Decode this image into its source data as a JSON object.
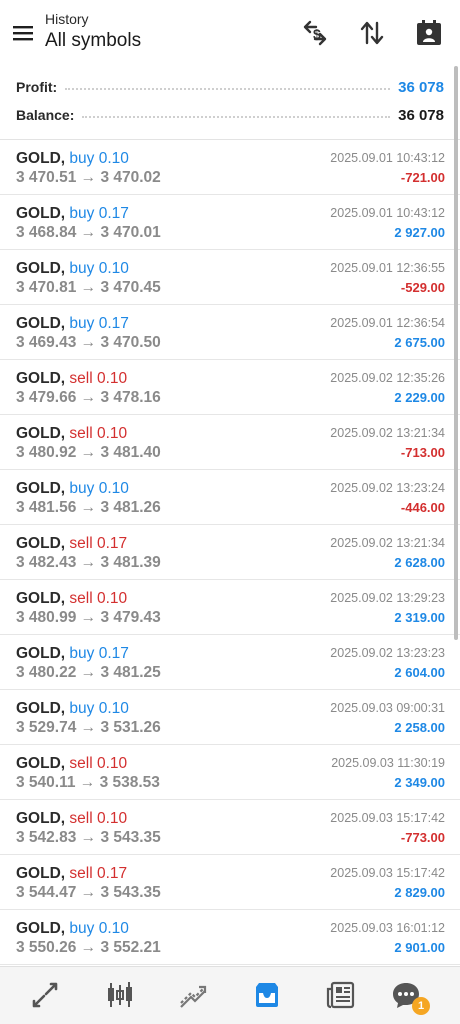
{
  "header": {
    "subtitle": "History",
    "title": "All symbols"
  },
  "summary": {
    "profit_label": "Profit:",
    "profit_value": "36 078",
    "balance_label": "Balance:",
    "balance_value": "36 078"
  },
  "colors": {
    "buy": "#1e88e5",
    "sell": "#d32f2f",
    "profit_positive": "#1e88e5",
    "profit_negative": "#d32f2f",
    "badge": "#f5a623"
  },
  "deals": [
    {
      "symbol": "GOLD,",
      "side": "buy",
      "volume": "0.10",
      "prices": "3 470.51 → 3 470.02",
      "time": "2025.09.01 10:43:12",
      "profit": "-721.00",
      "negative": true
    },
    {
      "symbol": "GOLD,",
      "side": "buy",
      "volume": "0.17",
      "prices": "3 468.84 → 3 470.01",
      "time": "2025.09.01 10:43:12",
      "profit": "2 927.00",
      "negative": false
    },
    {
      "symbol": "GOLD,",
      "side": "buy",
      "volume": "0.10",
      "prices": "3 470.81 → 3 470.45",
      "time": "2025.09.01 12:36:55",
      "profit": "-529.00",
      "negative": true
    },
    {
      "symbol": "GOLD,",
      "side": "buy",
      "volume": "0.17",
      "prices": "3 469.43 → 3 470.50",
      "time": "2025.09.01 12:36:54",
      "profit": "2 675.00",
      "negative": false
    },
    {
      "symbol": "GOLD,",
      "side": "sell",
      "volume": "0.10",
      "prices": "3 479.66 → 3 478.16",
      "time": "2025.09.02 12:35:26",
      "profit": "2 229.00",
      "negative": false
    },
    {
      "symbol": "GOLD,",
      "side": "sell",
      "volume": "0.10",
      "prices": "3 480.92 → 3 481.40",
      "time": "2025.09.02 13:21:34",
      "profit": "-713.00",
      "negative": true
    },
    {
      "symbol": "GOLD,",
      "side": "buy",
      "volume": "0.10",
      "prices": "3 481.56 → 3 481.26",
      "time": "2025.09.02 13:23:24",
      "profit": "-446.00",
      "negative": true
    },
    {
      "symbol": "GOLD,",
      "side": "sell",
      "volume": "0.17",
      "prices": "3 482.43 → 3 481.39",
      "time": "2025.09.02 13:21:34",
      "profit": "2 628.00",
      "negative": false
    },
    {
      "symbol": "GOLD,",
      "side": "sell",
      "volume": "0.10",
      "prices": "3 480.99 → 3 479.43",
      "time": "2025.09.02 13:29:23",
      "profit": "2 319.00",
      "negative": false
    },
    {
      "symbol": "GOLD,",
      "side": "buy",
      "volume": "0.17",
      "prices": "3 480.22 → 3 481.25",
      "time": "2025.09.02 13:23:23",
      "profit": "2 604.00",
      "negative": false
    },
    {
      "symbol": "GOLD,",
      "side": "buy",
      "volume": "0.10",
      "prices": "3 529.74 → 3 531.26",
      "time": "2025.09.03 09:00:31",
      "profit": "2 258.00",
      "negative": false
    },
    {
      "symbol": "GOLD,",
      "side": "sell",
      "volume": "0.10",
      "prices": "3 540.11 → 3 538.53",
      "time": "2025.09.03 11:30:19",
      "profit": "2 349.00",
      "negative": false
    },
    {
      "symbol": "GOLD,",
      "side": "sell",
      "volume": "0.10",
      "prices": "3 542.83 → 3 543.35",
      "time": "2025.09.03 15:17:42",
      "profit": "-773.00",
      "negative": true
    },
    {
      "symbol": "GOLD,",
      "side": "sell",
      "volume": "0.17",
      "prices": "3 544.47 → 3 543.35",
      "time": "2025.09.03 15:17:42",
      "profit": "2 829.00",
      "negative": false
    },
    {
      "symbol": "GOLD,",
      "side": "buy",
      "volume": "0.10",
      "prices": "3 550.26 → 3 552.21",
      "time": "2025.09.03 16:01:12",
      "profit": "2 901.00",
      "negative": false
    }
  ],
  "icons": {
    "header": [
      "menu-icon",
      "currency-exchange-icon",
      "sort-icon",
      "calendar-icon"
    ],
    "nav": [
      "quotes-icon",
      "chart-icon",
      "trade-icon",
      "history-icon",
      "news-icon",
      "chat-icon"
    ]
  },
  "bottom_nav": {
    "active": "history",
    "chat_badge": "1"
  }
}
